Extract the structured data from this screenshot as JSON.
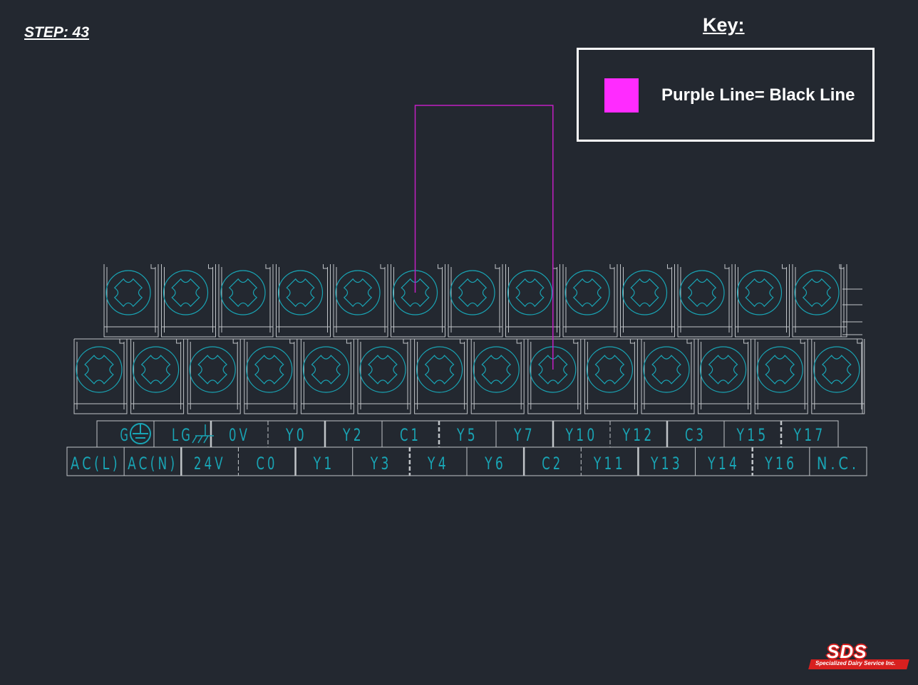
{
  "step_label": "STEP: 43",
  "key": {
    "title": "Key:",
    "swatch_color": "#ff2bff",
    "text": "Purple Line= Black Line"
  },
  "terminal_block": {
    "upper_row_labels": [
      "G",
      "LG",
      "0V",
      "Y0",
      "Y2",
      "C1",
      "Y5",
      "Y7",
      "Y10",
      "Y12",
      "C3",
      "Y15",
      "Y17"
    ],
    "lower_row_labels": [
      "AC(L)",
      "AC(N)",
      "24V",
      "C0",
      "Y1",
      "Y3",
      "Y4",
      "Y6",
      "C2",
      "Y11",
      "Y13",
      "Y14",
      "Y16",
      "N.C."
    ],
    "upper_screw_count": 13,
    "lower_screw_count": 14,
    "line_color": "#c0c4c8",
    "accent_color": "#19a4b4"
  },
  "wire": {
    "color": "#c21fc2",
    "from_screw": "upper-6",
    "to_screw": "lower-9"
  },
  "logo": {
    "letters": "SDS",
    "subtitle": "Specialized Dairy Service Inc.",
    "color": "#d8201f"
  }
}
